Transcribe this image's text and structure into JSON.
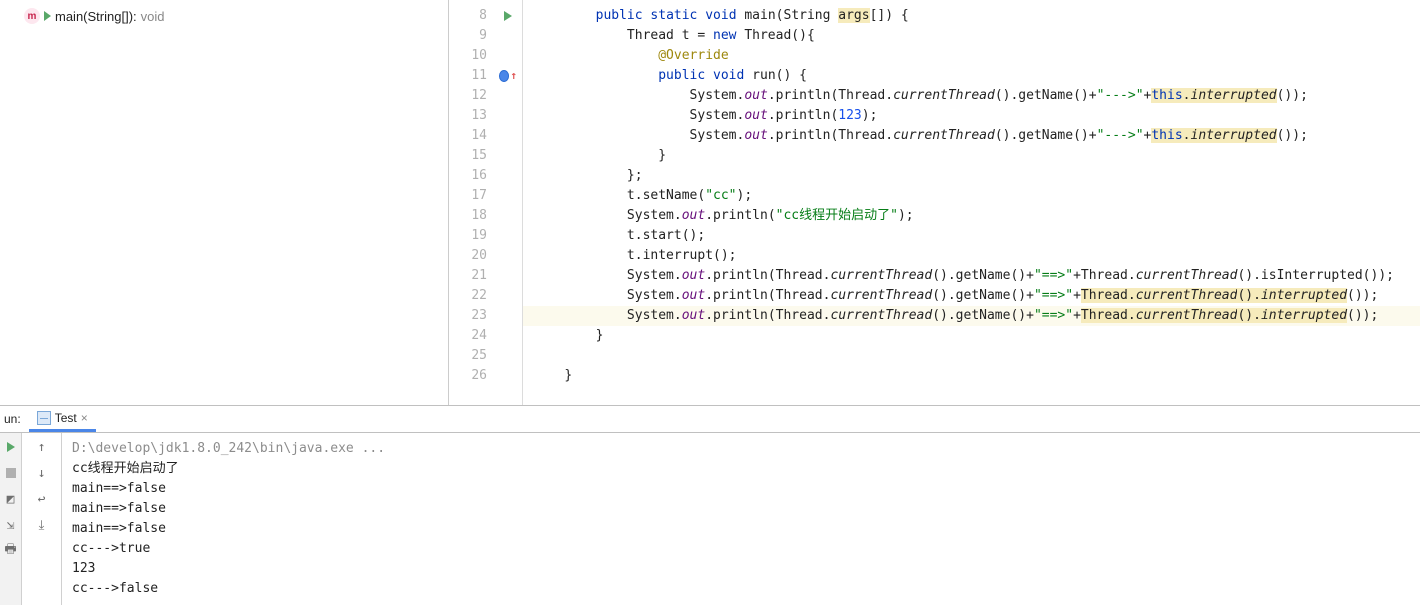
{
  "structure": {
    "method_letter": "m",
    "method_name": "main(String[]): ",
    "method_return": "void"
  },
  "gutter": {
    "start": 8,
    "end": 26,
    "run_marker_line": 8,
    "override_marker_line": 11,
    "highlight_line": 23
  },
  "code": [
    {
      "indent": 2,
      "tokens": [
        {
          "t": "public ",
          "c": "kw"
        },
        {
          "t": "static ",
          "c": "kw"
        },
        {
          "t": "void ",
          "c": "kw"
        },
        {
          "t": "main(String "
        },
        {
          "t": "args",
          "c": "warn-bg"
        },
        {
          "t": "[]) {"
        }
      ]
    },
    {
      "indent": 3,
      "tokens": [
        {
          "t": "Thread t = "
        },
        {
          "t": "new ",
          "c": "kw"
        },
        {
          "t": "Thread(){"
        }
      ]
    },
    {
      "indent": 4,
      "tokens": [
        {
          "t": "@Override",
          "c": "ann"
        }
      ]
    },
    {
      "indent": 4,
      "tokens": [
        {
          "t": "public ",
          "c": "kw"
        },
        {
          "t": "void ",
          "c": "kw"
        },
        {
          "t": "run() {"
        }
      ]
    },
    {
      "indent": 5,
      "tokens": [
        {
          "t": "System."
        },
        {
          "t": "out",
          "c": "field"
        },
        {
          "t": ".println(Thread."
        },
        {
          "t": "currentThread",
          "c": "italic-m"
        },
        {
          "t": "().getName()+"
        },
        {
          "t": "\"--->\"",
          "c": "str"
        },
        {
          "t": "+"
        },
        {
          "t": "this",
          "c": "kw warn-bg"
        },
        {
          "t": ".",
          "c": "warn-bg"
        },
        {
          "t": "interrupted",
          "c": "italic-m warn-bg"
        },
        {
          "t": "());"
        }
      ]
    },
    {
      "indent": 5,
      "tokens": [
        {
          "t": "System."
        },
        {
          "t": "out",
          "c": "field"
        },
        {
          "t": ".println("
        },
        {
          "t": "123",
          "c": "num"
        },
        {
          "t": ");"
        }
      ]
    },
    {
      "indent": 5,
      "tokens": [
        {
          "t": "System."
        },
        {
          "t": "out",
          "c": "field"
        },
        {
          "t": ".println(Thread."
        },
        {
          "t": "currentThread",
          "c": "italic-m"
        },
        {
          "t": "().getName()+"
        },
        {
          "t": "\"--->\"",
          "c": "str"
        },
        {
          "t": "+"
        },
        {
          "t": "this",
          "c": "kw warn-bg"
        },
        {
          "t": ".",
          "c": "warn-bg"
        },
        {
          "t": "interrupted",
          "c": "italic-m warn-bg"
        },
        {
          "t": "());"
        }
      ]
    },
    {
      "indent": 4,
      "tokens": [
        {
          "t": "}"
        }
      ]
    },
    {
      "indent": 3,
      "tokens": [
        {
          "t": "};"
        }
      ]
    },
    {
      "indent": 3,
      "tokens": [
        {
          "t": "t.setName("
        },
        {
          "t": "\"cc\"",
          "c": "str"
        },
        {
          "t": ");"
        }
      ]
    },
    {
      "indent": 3,
      "tokens": [
        {
          "t": "System."
        },
        {
          "t": "out",
          "c": "field"
        },
        {
          "t": ".println("
        },
        {
          "t": "\"cc线程开始启动了\"",
          "c": "str"
        },
        {
          "t": ");"
        }
      ]
    },
    {
      "indent": 3,
      "tokens": [
        {
          "t": "t.start();"
        }
      ]
    },
    {
      "indent": 3,
      "tokens": [
        {
          "t": "t.interrupt();"
        }
      ]
    },
    {
      "indent": 3,
      "tokens": [
        {
          "t": "System."
        },
        {
          "t": "out",
          "c": "field"
        },
        {
          "t": ".println(Thread."
        },
        {
          "t": "currentThread",
          "c": "italic-m"
        },
        {
          "t": "().getName()+"
        },
        {
          "t": "\"==>\"",
          "c": "str"
        },
        {
          "t": "+Thread."
        },
        {
          "t": "currentThread",
          "c": "italic-m"
        },
        {
          "t": "().isInterrupted());"
        }
      ]
    },
    {
      "indent": 3,
      "tokens": [
        {
          "t": "System."
        },
        {
          "t": "out",
          "c": "field"
        },
        {
          "t": ".println(Thread."
        },
        {
          "t": "currentThread",
          "c": "italic-m"
        },
        {
          "t": "().getName()+"
        },
        {
          "t": "\"==>\"",
          "c": "str"
        },
        {
          "t": "+"
        },
        {
          "t": "Thread.",
          "c": "warn-bg"
        },
        {
          "t": "currentThread",
          "c": "italic-m warn-bg"
        },
        {
          "t": "().",
          "c": "warn-bg"
        },
        {
          "t": "interrupted",
          "c": "italic-m warn-bg"
        },
        {
          "t": "());"
        }
      ]
    },
    {
      "indent": 3,
      "tokens": [
        {
          "t": "System."
        },
        {
          "t": "out",
          "c": "field"
        },
        {
          "t": ".println(Thread."
        },
        {
          "t": "currentThread",
          "c": "italic-m"
        },
        {
          "t": "().getName()+"
        },
        {
          "t": "\"==>\"",
          "c": "str"
        },
        {
          "t": "+"
        },
        {
          "t": "Thread.",
          "c": "warn-bg"
        },
        {
          "t": "currentThread",
          "c": "italic-m warn-bg"
        },
        {
          "t": "().",
          "c": "warn-bg"
        },
        {
          "t": "interrupted",
          "c": "italic-m warn-bg"
        },
        {
          "t": "());"
        }
      ]
    },
    {
      "indent": 2,
      "tokens": [
        {
          "t": "}"
        }
      ]
    },
    {
      "indent": 0,
      "tokens": []
    },
    {
      "indent": 1,
      "tokens": [
        {
          "t": "}"
        }
      ]
    }
  ],
  "run": {
    "label": "un:",
    "tab_name": "Test",
    "console": [
      {
        "text": "D:\\develop\\jdk1.8.0_242\\bin\\java.exe ...",
        "cls": "exec-line"
      },
      {
        "text": "cc线程开始启动了"
      },
      {
        "text": "main==>false"
      },
      {
        "text": "main==>false"
      },
      {
        "text": "main==>false"
      },
      {
        "text": "cc--->true"
      },
      {
        "text": "123"
      },
      {
        "text": "cc--->false"
      }
    ]
  }
}
